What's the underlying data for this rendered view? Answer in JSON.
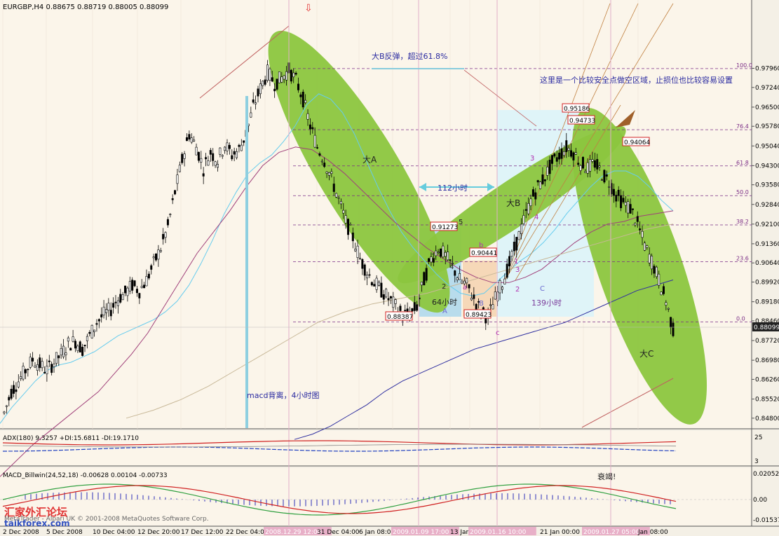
{
  "colors": {
    "background": "#f4f0e6",
    "plot_bg": "#fbf5ea",
    "grid": "#d8cfc0",
    "candle": "#000000",
    "ellipse": "#8cc63f",
    "fib": "#7b2d86",
    "ma_fast": "#66ccee",
    "ma_mid": "#a0407a",
    "ma_slow": "#3030a0",
    "ma_long": "#c8b898",
    "macd_sig": "#d02020",
    "macd_main": "#30a040",
    "hist": "#5050c0",
    "adx_red": "#d02020",
    "adx_blue": "#2040c0",
    "price_box_bg": "#222222",
    "logo_red": "#e03030",
    "logo_blue": "#3050c0"
  },
  "header": {
    "symbol_line": "EURGBP,H4  0.88675 0.88719 0.88005 0.88099",
    "arrow": "⇩"
  },
  "current_price": "0.88099",
  "chart_data": {
    "type": "line",
    "ylim": [
      0.844,
      0.9995
    ],
    "yticks": [
      "0.97960",
      "0.97240",
      "0.96500",
      "0.95780",
      "0.95040",
      "0.94300",
      "0.93580",
      "0.92840",
      "0.92100",
      "0.91360",
      "0.90640",
      "0.89920",
      "0.89180",
      "0.88460",
      "0.87720",
      "0.86980",
      "0.86260",
      "0.85520",
      "0.84800"
    ],
    "xlabels": [
      "2 Dec 2008",
      "5 Dec 2008",
      "10 Dec 04:00",
      "12 Dec 20:00",
      "17 Dec 12:00",
      "22 Dec 04:00",
      "2008.12.29 12:00",
      "31 Dec 04:00",
      "6 Jan 08:00",
      "2009.01.09 17:00",
      "13 Jan",
      "2009.01.16 10:00",
      "21 Jan 00:00",
      "2009.01.27 05:00",
      "Jan 08:00"
    ],
    "fib_levels": [
      {
        "label": "100.0",
        "value": 0.9795
      },
      {
        "label": "76.4",
        "value": 0.9565
      },
      {
        "label": "61.8",
        "value": 0.9429
      },
      {
        "label": "50.0",
        "value": 0.9317
      },
      {
        "label": "38.2",
        "value": 0.9207
      },
      {
        "label": "23.6",
        "value": 0.9069
      },
      {
        "label": "0.0",
        "value": 0.8842
      }
    ],
    "price_tags": [
      "0.95186",
      "0.94733",
      "0.94064",
      "0.91273",
      "0.90441",
      "0.88387",
      "0.89423"
    ],
    "series": [
      {
        "values": [
          0.85,
          0.858,
          0.862,
          0.866,
          0.87,
          0.868,
          0.866,
          0.869,
          0.872,
          0.876,
          0.877,
          0.874,
          0.879,
          0.884,
          0.887,
          0.889,
          0.893,
          0.895,
          0.898,
          0.896,
          0.9,
          0.906,
          0.912,
          0.92,
          0.933,
          0.945,
          0.955,
          0.95,
          0.942,
          0.948,
          0.945,
          0.951,
          0.947,
          0.949,
          0.955,
          0.965,
          0.972,
          0.978,
          0.974,
          0.976,
          0.979,
          0.975,
          0.968,
          0.958,
          0.95,
          0.945,
          0.938,
          0.93,
          0.922,
          0.916,
          0.908,
          0.903,
          0.899,
          0.896,
          0.893,
          0.89,
          0.887,
          0.887,
          0.89,
          0.9,
          0.908,
          0.912,
          0.909,
          0.905,
          0.9,
          0.898,
          0.893,
          0.888,
          0.886,
          0.893,
          0.899,
          0.906,
          0.914,
          0.922,
          0.93,
          0.935,
          0.939,
          0.944,
          0.947,
          0.95,
          0.948,
          0.944,
          0.942,
          0.944,
          0.94,
          0.937,
          0.932,
          0.929,
          0.927,
          0.921,
          0.913,
          0.907,
          0.9,
          0.892,
          0.881
        ]
      }
    ],
    "ma_series": {
      "fast": [
        0.846,
        0.852,
        0.857,
        0.862,
        0.866,
        0.868,
        0.869,
        0.871,
        0.873,
        0.876,
        0.879,
        0.881,
        0.883,
        0.885,
        0.888,
        0.892,
        0.898,
        0.906,
        0.915,
        0.925,
        0.933,
        0.94,
        0.944,
        0.947,
        0.952,
        0.958,
        0.966,
        0.97,
        0.968,
        0.963,
        0.955,
        0.945,
        0.935,
        0.926,
        0.918,
        0.912,
        0.907,
        0.902,
        0.898,
        0.895,
        0.894,
        0.895,
        0.899,
        0.903,
        0.907,
        0.91,
        0.914,
        0.919,
        0.925,
        0.93,
        0.935,
        0.939,
        0.941,
        0.941,
        0.939,
        0.935,
        0.93,
        0.926
      ],
      "mid": [
        0.826,
        0.832,
        0.838,
        0.843,
        0.848,
        0.853,
        0.858,
        0.865,
        0.872,
        0.88,
        0.89,
        0.9,
        0.91,
        0.918,
        0.926,
        0.935,
        0.943,
        0.948,
        0.95,
        0.949,
        0.945,
        0.94,
        0.934,
        0.928,
        0.922,
        0.917,
        0.912,
        0.908,
        0.904,
        0.901,
        0.899,
        0.899,
        0.901,
        0.904,
        0.909,
        0.914,
        0.918,
        0.921,
        0.922,
        0.924,
        0.925,
        0.926
      ],
      "slow": [
        0.84,
        0.842,
        0.845,
        0.849,
        0.853,
        0.858,
        0.862,
        0.865,
        0.868,
        0.871,
        0.874,
        0.876,
        0.878,
        0.88,
        0.882,
        0.884,
        0.887,
        0.89,
        0.893,
        0.896,
        0.898,
        0.9
      ],
      "long": [
        0.848,
        0.851,
        0.855,
        0.86,
        0.866,
        0.872,
        0.878,
        0.884,
        0.888,
        0.891,
        0.893,
        0.895,
        0.898,
        0.901,
        0.904,
        0.907,
        0.91,
        0.913,
        0.916,
        0.919,
        0.921
      ]
    }
  },
  "annotations": {
    "big_b_rebound": "大B反弹，超过61.8%",
    "safe_short": "这里是一个比较安全点做空区域，止损位也比较容易设置",
    "big_a": "大A",
    "big_b": "大B",
    "big_c": "大C",
    "hours_112": "112小时",
    "hours_64": "64小时",
    "hours_139": "139小时",
    "macd_div": "macd背离，4小时图",
    "decline": "衰竭!",
    "w1": "1",
    "w2": "2",
    "w3": "3",
    "w4": "4",
    "w5": "5",
    "wa": "a",
    "wb": "b",
    "wc": "c",
    "sA": "A",
    "sB": "B",
    "sC": "C",
    "w3b": "3",
    "w2b": "2",
    "w1b": "1",
    "w4b": "4",
    "w3c": "3"
  },
  "adx": {
    "label": "ADX(180) 9.3257 +DI:15.6811 -DI:19.1710",
    "ticks": [
      "25",
      "3"
    ]
  },
  "macd": {
    "label": "MACD_Billwin(24,52,18) -0.00628 0.00104 -0.00733",
    "ticks": [
      "0.02052",
      "0.00",
      "-0.01537"
    ]
  },
  "watermark": {
    "logo_text": "汇家外汇论坛",
    "logo_site": "taikforex.com",
    "copyright": "MetaTrader - Alpari UK © 2001-2008 MetaQuotes Software Corp."
  }
}
